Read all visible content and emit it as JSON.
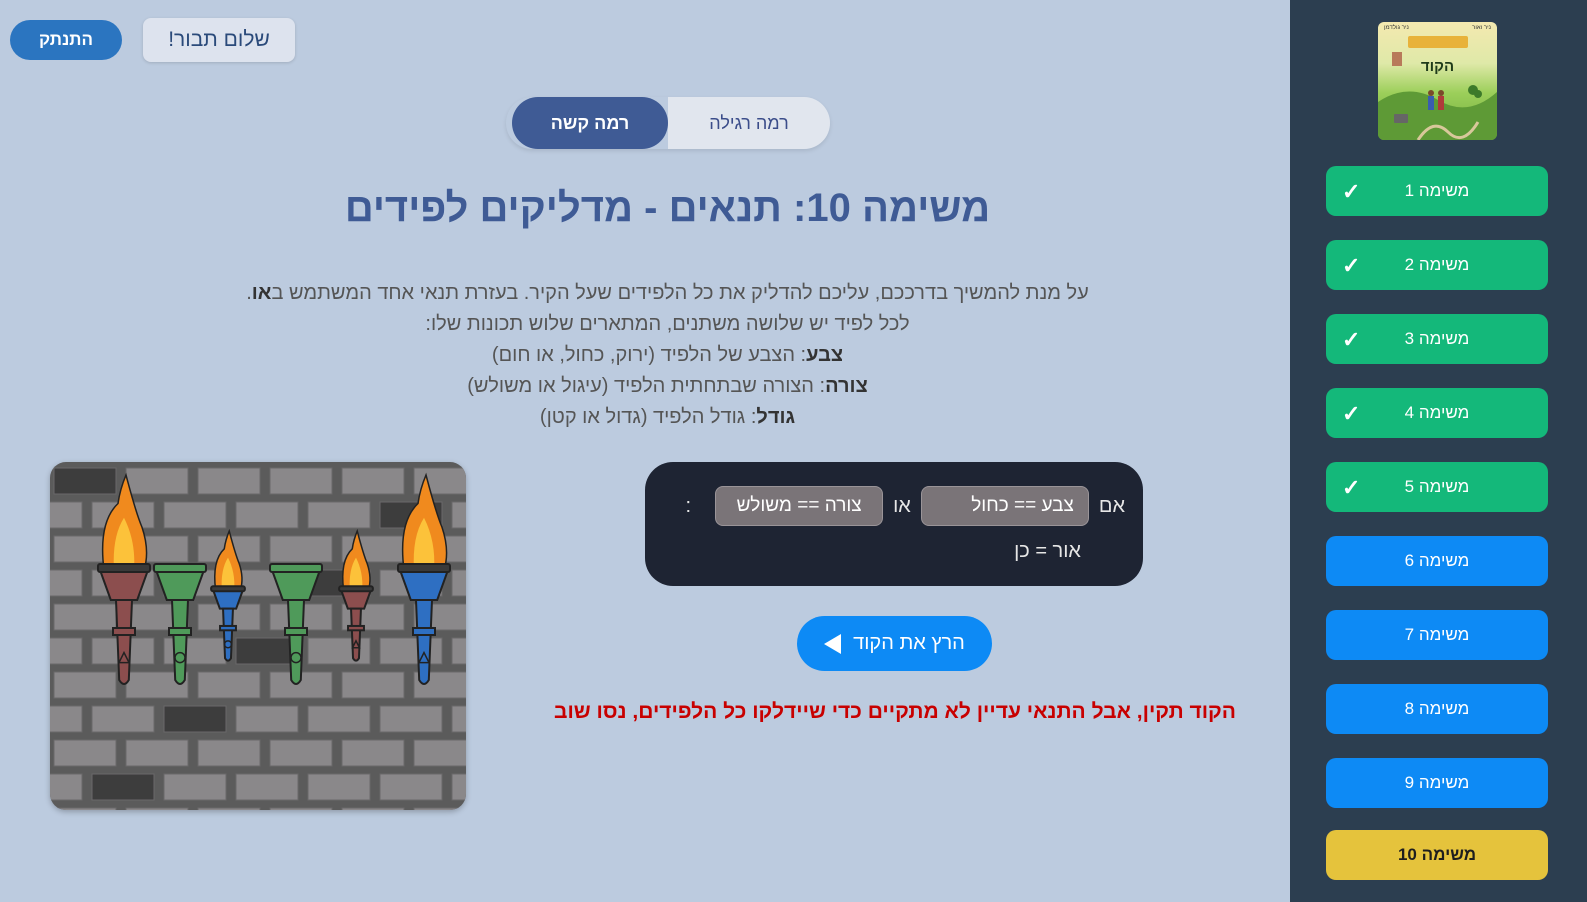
{
  "header": {
    "logout_label": "התנתק",
    "greeting_label": "שלום תבור!"
  },
  "levels": {
    "hard_label": "רמה קשה",
    "normal_label": "רמה רגילה",
    "selected": "hard"
  },
  "title": "משימה 10: תנאים - מדליקים לפידים",
  "description": {
    "line1": "על מנת להמשיך בדרככם, עליכם להדליק את כל הלפידים שעל הקיר. בעזרת תנאי אחד המשתמש ב",
    "line1_bold": "או",
    "line1_end": ".",
    "line2": "לכל לפיד יש שלושה משתנים, המתארים שלוש תכונות שלו:",
    "line3_bold": "צבע",
    "line3": ": הצבע של הלפיד (ירוק, כחול, או חום)",
    "line4_bold": "צורה",
    "line4": ": הצורה שבתחתית הלפיד (עיגול או משולש)",
    "line5_bold": "גודל",
    "line5": ": גודל הלפיד (גדול או קטן)"
  },
  "code": {
    "if_keyword": "אם",
    "condition1": "צבע == כחול",
    "or_keyword": "או",
    "condition2": "צורה == משולש",
    "colon": ":",
    "action": "אור = כן"
  },
  "run_label": "הרץ את הקוד",
  "feedback": "הקוד תקין, אבל התנאי עדיין לא מתקיים כדי שיידלקו כל הלפידים, נסו שוב",
  "sidebar": {
    "cover": {
      "title": "הקוד",
      "top_left": "ניר גולדמן",
      "top_right": "ניר ואור"
    },
    "missions": [
      {
        "label": "משימה 1",
        "status": "done",
        "check": "✓"
      },
      {
        "label": "משימה 2",
        "status": "done",
        "check": "✓"
      },
      {
        "label": "משימה 3",
        "status": "done",
        "check": "✓"
      },
      {
        "label": "משימה 4",
        "status": "done",
        "check": "✓"
      },
      {
        "label": "משימה 5",
        "status": "done",
        "check": "✓"
      },
      {
        "label": "משימה 6",
        "status": "todo"
      },
      {
        "label": "משימה 7",
        "status": "todo"
      },
      {
        "label": "משימה 8",
        "status": "todo"
      },
      {
        "label": "משימה 9",
        "status": "todo"
      },
      {
        "label": "משימה 10",
        "status": "current"
      }
    ]
  },
  "torches": [
    {
      "color": "brown",
      "shape": "triangle",
      "size": "big",
      "lit": true
    },
    {
      "color": "green",
      "shape": "circle",
      "size": "big",
      "lit": false
    },
    {
      "color": "blue",
      "shape": "circle",
      "size": "small",
      "lit": true
    },
    {
      "color": "green",
      "shape": "circle",
      "size": "big",
      "lit": false
    },
    {
      "color": "brown",
      "shape": "triangle",
      "size": "small",
      "lit": true
    },
    {
      "color": "blue",
      "shape": "triangle",
      "size": "big",
      "lit": true
    }
  ],
  "colors": {
    "background": "#bccbdf",
    "sidebar": "#2c3e50",
    "mission_done": "#14b87a",
    "mission_todo": "#0d8af5",
    "mission_current": "#e5c33c",
    "title": "#3f5b95",
    "error": "#c80000"
  }
}
